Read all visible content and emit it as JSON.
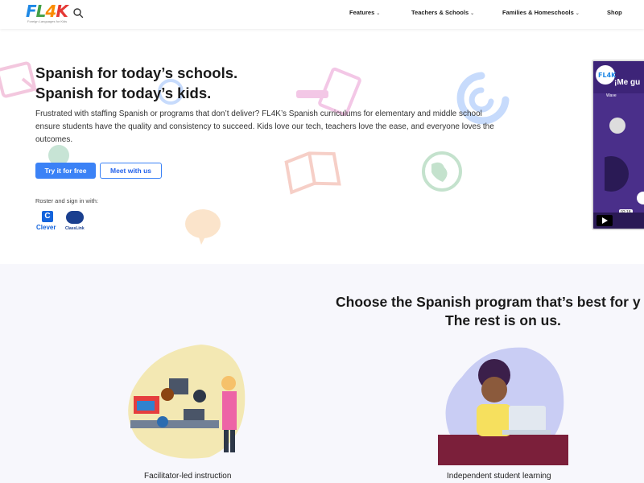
{
  "header": {
    "logo_text": "FL4K",
    "logo_tagline": "Foreign Languages for Kids",
    "search_icon": "search-icon",
    "nav": [
      {
        "label": "Features",
        "has_dropdown": true
      },
      {
        "label": "Teachers & Schools",
        "has_dropdown": true
      },
      {
        "label": "Families & Homeschools",
        "has_dropdown": true
      },
      {
        "label": "Shop",
        "has_dropdown": false
      }
    ]
  },
  "hero": {
    "title_line1": "Spanish for today’s schools.",
    "title_line2": "Spanish for today’s kids.",
    "description": "Frustrated with staffing Spanish or programs that don’t deliver? FL4K’s Spanish curriculums for elementary and middle school ensure students have the quality and consistency to succeed. Kids love our tech, teachers love the ease, and everyone loves the outcomes.",
    "primary_button": "Try it for free",
    "secondary_button": "Meet with us",
    "roster_label": "Roster and sign in with:",
    "clever_label": "Clever",
    "clever_letter": "C",
    "classlink_label": "ClassLink"
  },
  "video": {
    "title": "¡Me gu",
    "wave_label": "Wave",
    "timestamp": "02:18"
  },
  "programs": {
    "title_line1": "Choose the Spanish program that’s best for y",
    "title_line2": "The rest is on us.",
    "items": [
      {
        "label": "Facilitator-led instruction"
      },
      {
        "label": "Independent student learning"
      }
    ]
  },
  "colors": {
    "primary": "#3b82f6",
    "video_purple": "#4a2f8a",
    "section_bg": "#f7f7fc"
  }
}
